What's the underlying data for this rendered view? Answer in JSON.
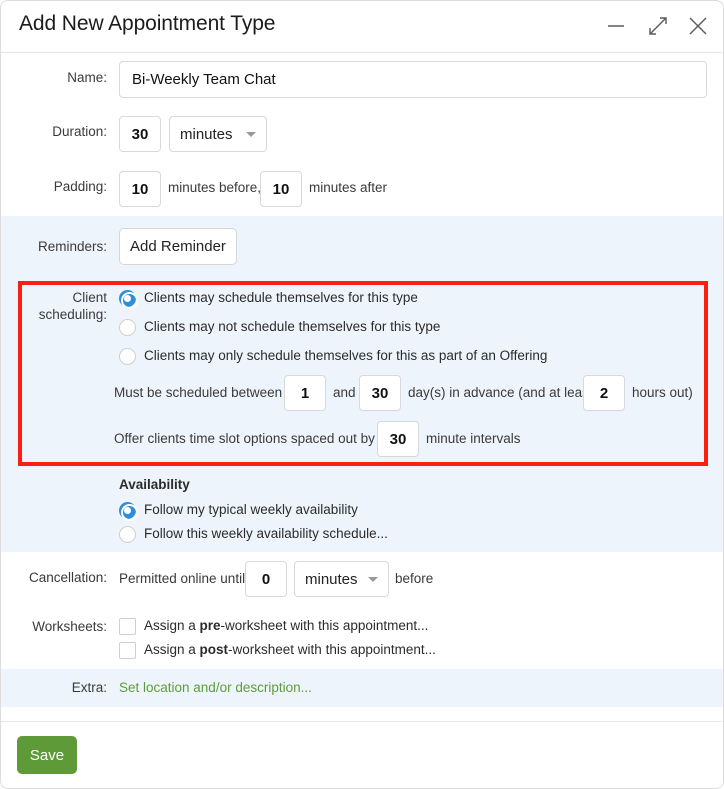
{
  "window": {
    "title": "Add New Appointment Type",
    "controls": [
      {
        "name": "minimize-button",
        "glyph": "minimize"
      },
      {
        "name": "restore-button",
        "glyph": "restore"
      },
      {
        "name": "close-button",
        "glyph": "close"
      }
    ]
  },
  "form": {
    "name": {
      "label": "Name:",
      "value": "Bi-Weekly Team Chat",
      "placeholder": ""
    },
    "duration": {
      "label": "Duration:",
      "value": "30",
      "unit": "minutes"
    },
    "padding": {
      "label": "Padding:",
      "before_value": "10",
      "before_text": "minutes before,",
      "after_value": "10",
      "after_text": "minutes after"
    },
    "reminders": {
      "label": "Reminders:",
      "add_button": "Add Reminder"
    },
    "client_scheduling": {
      "label": "Client scheduling:",
      "options": [
        {
          "label": "Clients may schedule themselves for this type",
          "selected": true
        },
        {
          "label": "Clients may not schedule themselves for this type",
          "selected": false
        },
        {
          "label": "Clients may only schedule themselves for this as part of an Offering",
          "selected": false
        }
      ],
      "advance_prefix": "Must be scheduled between",
      "advance_min": "1",
      "advance_joiner": "and",
      "advance_max": "30",
      "advance_suffix": "day(s) in advance (and at least",
      "hours_value": "2",
      "hours_suffix": "hours out)",
      "slot_prefix": "Offer clients time slot options spaced out by",
      "slot_value": "30",
      "slot_suffix": "minute intervals"
    },
    "availability": {
      "heading": "Availability",
      "options": [
        {
          "label": "Follow my typical weekly availability",
          "selected": true
        },
        {
          "label": "Follow this weekly availability schedule...",
          "selected": false
        }
      ]
    },
    "cancellation": {
      "label": "Cancellation:",
      "prefix": "Permitted online until",
      "value": "0",
      "unit": "minutes",
      "suffix": "before"
    },
    "worksheets": {
      "label": "Worksheets:",
      "items": [
        {
          "prefix": "Assign a ",
          "emphasis": "pre",
          "suffix": "-worksheet with this appointment...",
          "checked": false
        },
        {
          "prefix": "Assign a ",
          "emphasis": "post",
          "suffix": "-worksheet with this appointment...",
          "checked": false
        }
      ]
    },
    "extra": {
      "label": "Extra:",
      "link": "Set location and/or description..."
    }
  },
  "footer": {
    "save_label": "Save"
  },
  "colors": {
    "accent_radio": "#2e8fd8",
    "save_green": "#5e9b38",
    "link_green": "#5d9c3c",
    "highlight_red": "#fb1f12",
    "band_blue": "#eef4fb"
  }
}
